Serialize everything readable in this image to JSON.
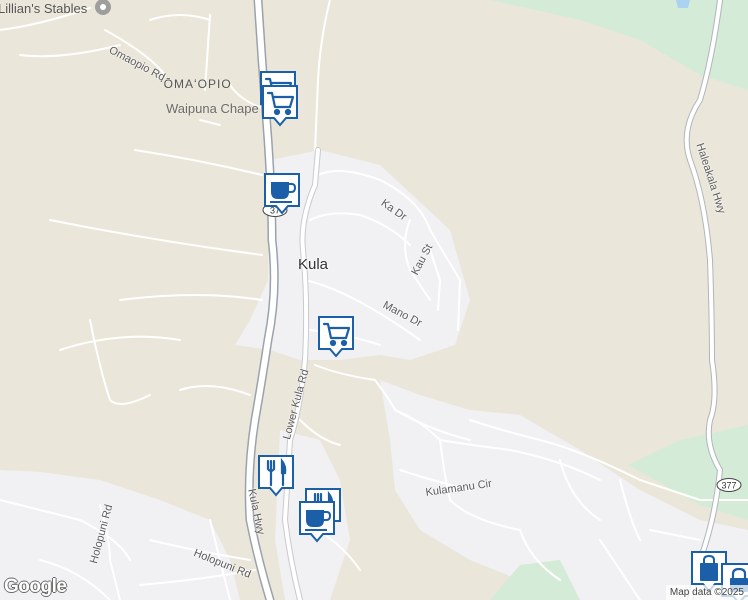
{
  "map": {
    "colors": {
      "land": "#ebe6da",
      "urban": "#f1f0f3",
      "park": "#d4ecd7",
      "road": "#ffffff",
      "highway_casing": "#9aa2ad",
      "water": "#aad3f2",
      "poi_marker": "#1a5fa8"
    },
    "place_labels": {
      "stables": "Lillian's Stables",
      "omaopio": "ʻŌMAʻOPIO",
      "chapel": "Waipuna Chape",
      "town": "Kula"
    },
    "road_labels": {
      "omaopio_rd": "Omaopio Rd",
      "ka_dr": "Ka Dr",
      "kau_st": "Kau St",
      "mano_dr": "Mano Dr",
      "lower_kula_rd": "Lower Kula Rd",
      "kula_hwy": "Kula Hwy",
      "haleakala_hwy": "Haleakala Hwy",
      "kulamanu_cir": "Kulamanu Cir",
      "holopuni_rd_1": "Holopuni Rd",
      "holopuni_rd_2": "Holopuni Rd"
    },
    "route_shields": {
      "route_377_west": "37",
      "route_377_east": "377"
    },
    "pois": [
      {
        "icon": "shopping-cart-icon",
        "kind": "grocery"
      },
      {
        "icon": "shopping-cart-icon",
        "kind": "grocery"
      },
      {
        "icon": "coffee-cup-icon",
        "kind": "cafe"
      },
      {
        "icon": "shopping-cart-icon",
        "kind": "grocery"
      },
      {
        "icon": "fork-knife-icon",
        "kind": "restaurant"
      },
      {
        "icon": "fork-knife-icon",
        "kind": "restaurant"
      },
      {
        "icon": "coffee-cup-icon",
        "kind": "cafe"
      },
      {
        "icon": "shopping-bag-icon",
        "kind": "shop"
      },
      {
        "icon": "lock-icon",
        "kind": "shop"
      }
    ],
    "attribution": "Map data ©2025",
    "logo": "Google"
  }
}
